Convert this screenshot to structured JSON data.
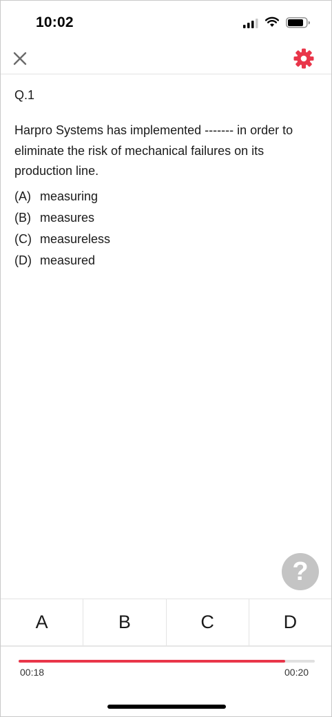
{
  "status_bar": {
    "time": "10:02"
  },
  "top_bar": {
    "close_icon": "close-icon",
    "settings_icon": "gear-icon",
    "accent": "#e9364a"
  },
  "question": {
    "number": "Q.1",
    "text": "Harpro Systems has implemented ------- in order to eliminate the risk of mechanical failures on its production line.",
    "options": [
      {
        "letter": "(A)",
        "text": "measuring"
      },
      {
        "letter": "(B)",
        "text": "measures"
      },
      {
        "letter": "(C)",
        "text": "measureless"
      },
      {
        "letter": "(D)",
        "text": "measured"
      }
    ]
  },
  "help": {
    "label": "?"
  },
  "answers": [
    "A",
    "B",
    "C",
    "D"
  ],
  "timer": {
    "elapsed": "00:18",
    "total": "00:20",
    "progress": 0.9
  }
}
